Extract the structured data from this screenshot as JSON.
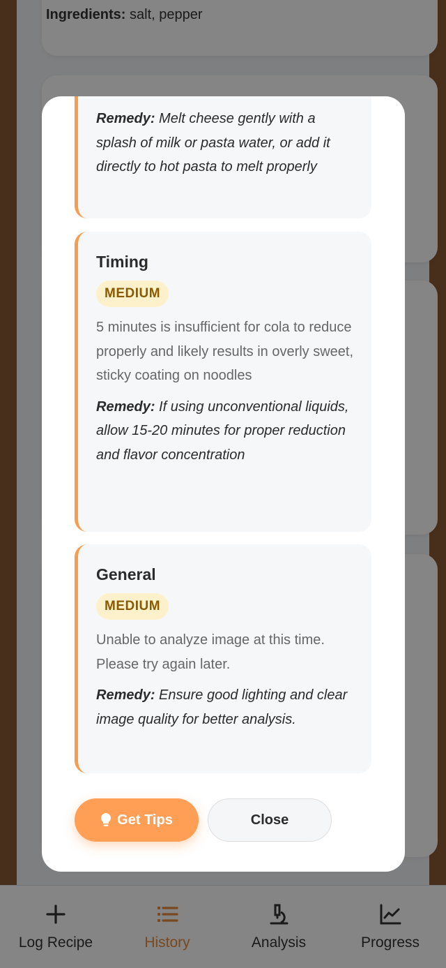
{
  "background": {
    "ingredients_label": "Ingredients:",
    "ingredients_value": "salt, pepper"
  },
  "modal": {
    "partial_remedy": {
      "label": "Remedy:",
      "text": "Melt cheese gently with a splash of milk or pasta water, or add it directly to hot pasta to melt properly"
    },
    "issues": [
      {
        "title": "Timing",
        "severity": "MEDIUM",
        "description": "5 minutes is insufficient for cola to reduce properly and likely results in overly sweet, sticky coating on noodles",
        "remedy_label": "Remedy:",
        "remedy": "If using unconventional liquids, allow 15-20 minutes for proper reduction and flavor concentration"
      },
      {
        "title": "General",
        "severity": "MEDIUM",
        "description": "Unable to analyze image at this time. Please try again later.",
        "remedy_label": "Remedy:",
        "remedy": "Ensure good lighting and clear image quality for better analysis."
      }
    ],
    "get_tips_label": "Get Tips",
    "get_tips_icon": "lightbulb-icon",
    "close_label": "Close"
  },
  "nav": {
    "items": [
      {
        "label": "Log Recipe",
        "icon": "plus-icon"
      },
      {
        "label": "History",
        "icon": "list-icon",
        "active": true
      },
      {
        "label": "Analysis",
        "icon": "microscope-icon"
      },
      {
        "label": "Progress",
        "icon": "chart-line-icon"
      }
    ]
  },
  "colors": {
    "accent": "#ff9f55",
    "accent_border": "#f59e4f",
    "badge_bg": "#fdf1cc",
    "badge_text": "#8a5a00"
  }
}
